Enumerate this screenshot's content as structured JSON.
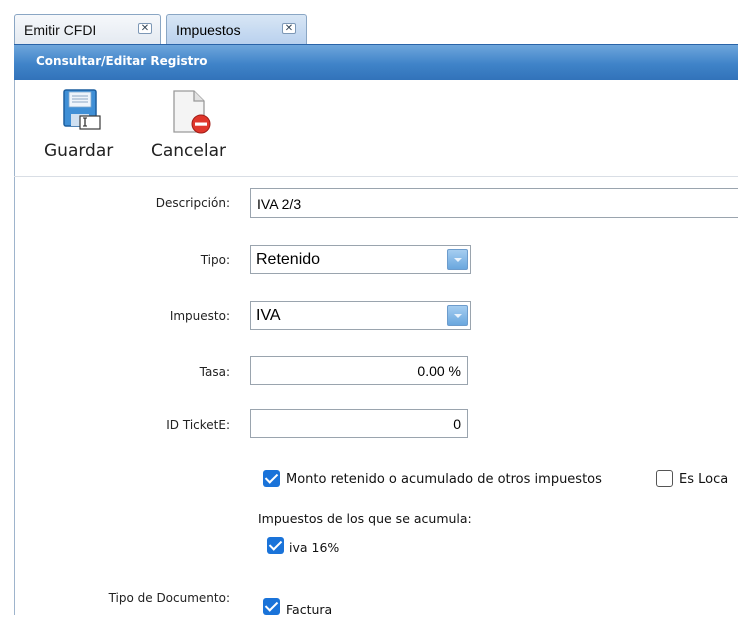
{
  "tabs": [
    {
      "label": "Emitir CFDI",
      "close": "✕"
    },
    {
      "label": "Impuestos",
      "close": "✕"
    }
  ],
  "panel": {
    "title": "Consultar/Editar Registro"
  },
  "toolbar": {
    "save_label": "Guardar",
    "cancel_label": "Cancelar"
  },
  "form": {
    "descripcion": {
      "label": "Descripción:",
      "value": "IVA 2/3"
    },
    "tipo": {
      "label": "Tipo:",
      "value": "Retenido"
    },
    "impuesto": {
      "label": "Impuesto:",
      "value": "IVA"
    },
    "tasa": {
      "label": "Tasa:",
      "value": "0.00 %"
    },
    "id_ticket": {
      "label": "ID TicketE:",
      "value": "0"
    },
    "monto_retenido": {
      "label": "Monto retenido o acumulado de otros impuestos",
      "checked": true
    },
    "es_local": {
      "label": "Es Loca",
      "checked": false
    },
    "acumula_header": "Impuestos de los que se acumula:",
    "acumula_items": [
      {
        "label": "iva 16%",
        "checked": true
      }
    ],
    "tipo_documento": {
      "label": "Tipo de Documento:"
    },
    "documento_items": [
      {
        "label": "Factura",
        "checked": true
      }
    ]
  },
  "colors": {
    "accent": "#1a73d9",
    "header": "#3f83c8"
  }
}
